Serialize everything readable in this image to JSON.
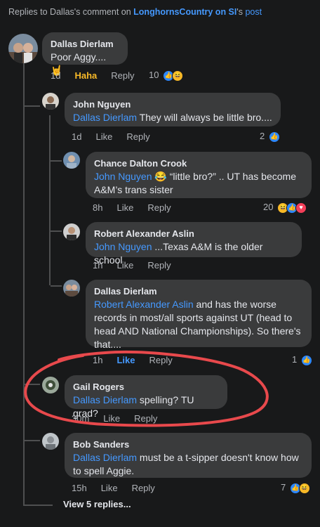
{
  "header": {
    "prefix": "Replies to Dallas's comment on ",
    "page": "LonghornsCountry on SI",
    "suffix": "'s ",
    "post": "post"
  },
  "comments": [
    {
      "name": "Dallas Dierlam",
      "mention": "",
      "text": "Poor Aggy.... 🤘",
      "time": "1d",
      "reaction": "Haha",
      "reply": "Reply",
      "count": "10"
    },
    {
      "name": "John Nguyen",
      "mention": "Dallas Dierlam",
      "text": " They will always be little bro....",
      "time": "1d",
      "like": "Like",
      "reply": "Reply",
      "count": "2"
    },
    {
      "name": "Chance Dalton Crook",
      "mention": "John Nguyen",
      "text": " 😂 “little bro?” .. UT has become A&M’s trans sister",
      "time": "8h",
      "like": "Like",
      "reply": "Reply",
      "count": "20"
    },
    {
      "name": "Robert Alexander Aslin",
      "mention": "John Nguyen",
      "text": " ...Texas A&M is the older school",
      "time": "1h",
      "like": "Like",
      "reply": "Reply"
    },
    {
      "name": "Dallas Dierlam",
      "mention": "Robert Alexander Aslin",
      "text": " and has the worse records in most/all sports against UT (head to head AND National Championships).  So there's that....",
      "time": "1h",
      "like": "Like",
      "reply": "Reply",
      "count": "1"
    },
    {
      "name": "Gail Rogers",
      "mention": "Dallas Dierlam",
      "text": " spelling? TU grad?",
      "time": "30m",
      "like": "Like",
      "reply": "Reply"
    },
    {
      "name": "Bob Sanders",
      "mention": "Dallas Dierlam",
      "text": " must be a t-sipper doesn't know how to spell Aggie.",
      "time": "15h",
      "like": "Like",
      "reply": "Reply",
      "count": "7"
    }
  ],
  "view_more": "View 5 replies...",
  "colors": {
    "annotation": "#e8494c",
    "link": "#4599ff",
    "haha": "#f7b928",
    "background": "#18191a",
    "bubble": "#3a3b3c"
  }
}
